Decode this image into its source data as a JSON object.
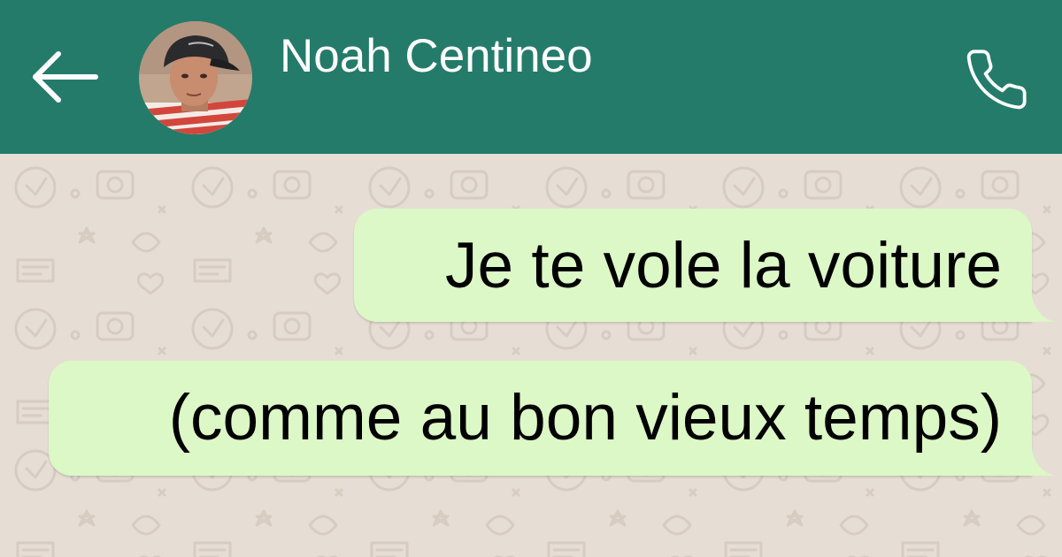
{
  "header": {
    "contact_name": "Noah Centineo",
    "background_color": "#247b6a",
    "back_icon": "arrow-left-icon",
    "call_icon": "phone-icon"
  },
  "chat": {
    "wallpaper_color": "#e6ddd4",
    "bubble_color": "#dcf8c6",
    "messages": [
      {
        "text": "Je te vole la voiture",
        "direction": "outgoing"
      },
      {
        "text": "(comme au bon vieux temps)",
        "direction": "outgoing"
      }
    ]
  }
}
